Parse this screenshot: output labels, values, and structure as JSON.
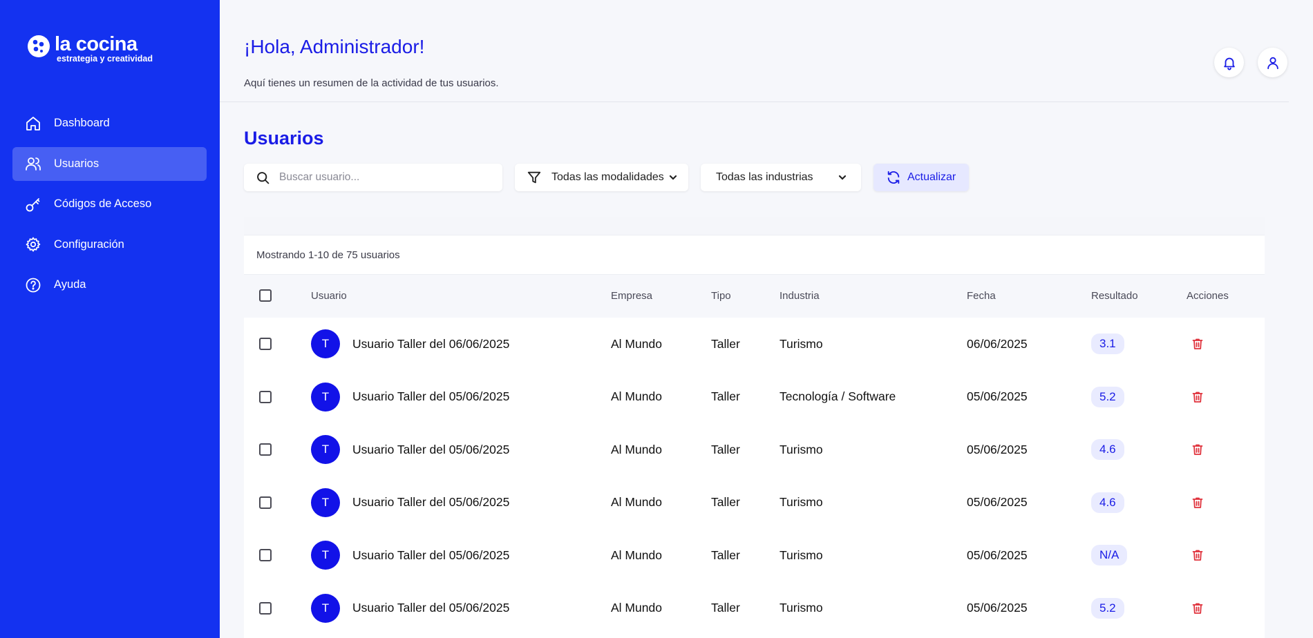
{
  "brand": {
    "name": "la cocina",
    "tagline": "estrategia y creatividad"
  },
  "sidebar": {
    "items": [
      {
        "label": "Dashboard",
        "icon": "home-icon",
        "active": false
      },
      {
        "label": "Usuarios",
        "icon": "users-icon",
        "active": true
      },
      {
        "label": "Códigos de Acceso",
        "icon": "key-icon",
        "active": false
      },
      {
        "label": "Configuración",
        "icon": "gear-icon",
        "active": false
      },
      {
        "label": "Ayuda",
        "icon": "help-icon",
        "active": false
      }
    ]
  },
  "header": {
    "greeting": "¡Hola, Administrador!",
    "subtitle": "Aquí tienes un resumen de la actividad de tus usuarios."
  },
  "section": {
    "title": "Usuarios"
  },
  "toolbar": {
    "search_placeholder": "Buscar usuario...",
    "modalidad": "Todas las modalidades",
    "industria": "Todas las industrias",
    "refresh": "Actualizar"
  },
  "table": {
    "count_text": "Mostrando 1-10 de 75 usuarios",
    "columns": [
      "Usuario",
      "Empresa",
      "Tipo",
      "Industria",
      "Fecha",
      "Resultado",
      "Acciones"
    ],
    "rows": [
      {
        "initial": "T",
        "usuario": "Usuario Taller del 06/06/2025",
        "empresa": "Al Mundo",
        "tipo": "Taller",
        "industria": "Turismo",
        "fecha": "06/06/2025",
        "resultado": "3.1"
      },
      {
        "initial": "T",
        "usuario": "Usuario Taller del 05/06/2025",
        "empresa": "Al Mundo",
        "tipo": "Taller",
        "industria": "Tecnología / Software",
        "fecha": "05/06/2025",
        "resultado": "5.2"
      },
      {
        "initial": "T",
        "usuario": "Usuario Taller del 05/06/2025",
        "empresa": "Al Mundo",
        "tipo": "Taller",
        "industria": "Turismo",
        "fecha": "05/06/2025",
        "resultado": "4.6"
      },
      {
        "initial": "T",
        "usuario": "Usuario Taller del 05/06/2025",
        "empresa": "Al Mundo",
        "tipo": "Taller",
        "industria": "Turismo",
        "fecha": "05/06/2025",
        "resultado": "4.6"
      },
      {
        "initial": "T",
        "usuario": "Usuario Taller del 05/06/2025",
        "empresa": "Al Mundo",
        "tipo": "Taller",
        "industria": "Turismo",
        "fecha": "05/06/2025",
        "resultado": "N/A"
      },
      {
        "initial": "T",
        "usuario": "Usuario Taller del 05/06/2025",
        "empresa": "Al Mundo",
        "tipo": "Taller",
        "industria": "Turismo",
        "fecha": "05/06/2025",
        "resultado": "5.2"
      }
    ]
  },
  "colors": {
    "brand_blue": "#1432f0",
    "accent": "#1a1ce6",
    "danger": "#e0323c"
  }
}
